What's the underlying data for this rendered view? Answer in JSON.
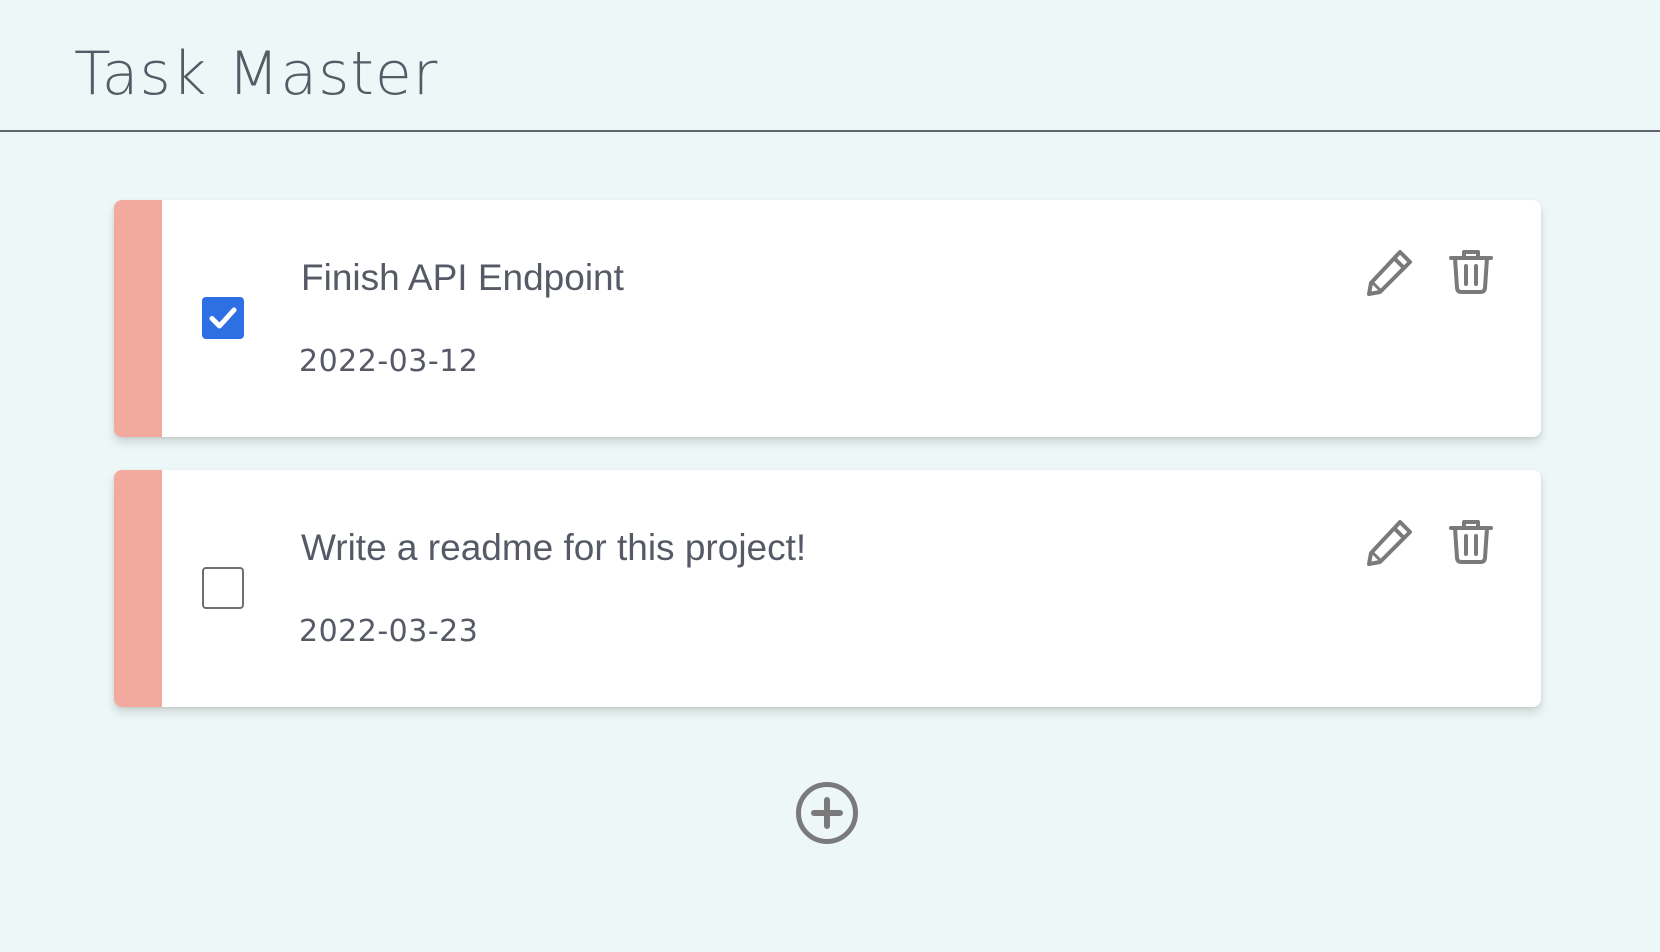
{
  "app": {
    "title": "Task Master"
  },
  "colors": {
    "background": "#eef7f7",
    "text": "#555a66",
    "priority_stripe": "#f2a99e",
    "checkbox_checked": "#2f6fe4",
    "icon": "#7a7a7a"
  },
  "tasks": [
    {
      "title": "Finish API Endpoint",
      "date": "2022-03-12",
      "completed": true
    },
    {
      "title": "Write a readme for this project!",
      "date": "2022-03-23",
      "completed": false
    }
  ],
  "icons": {
    "edit": "pencil-icon",
    "delete": "trash-icon",
    "add": "plus-circle-icon",
    "check": "checkmark-icon"
  }
}
